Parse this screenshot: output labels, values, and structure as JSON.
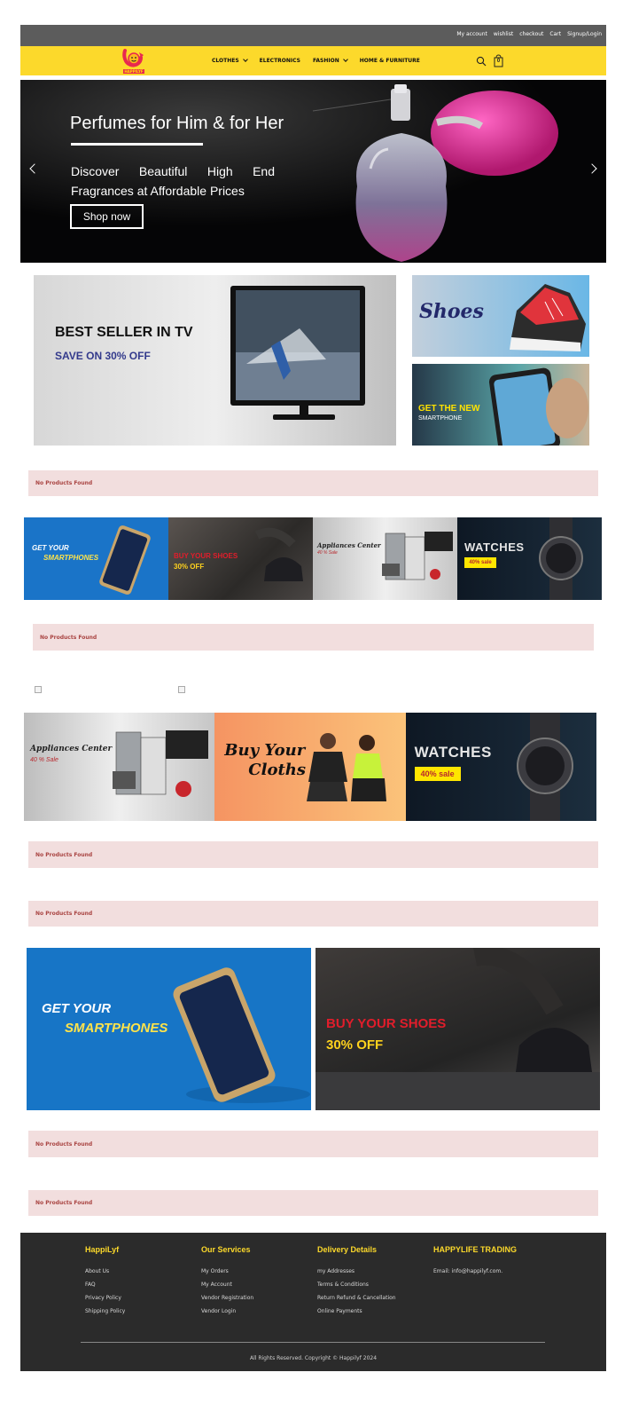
{
  "topbar": {
    "links": [
      "My account",
      "wishlist",
      "checkout",
      "Cart",
      "Signup/Login"
    ]
  },
  "brand": {
    "logo_text": "HAPPILYF",
    "colors": {
      "yellow": "#fcd92b",
      "dark": "#2b2b2b",
      "grey": "#5c5c5c"
    }
  },
  "nav": {
    "items": [
      {
        "label": "CLOTHES",
        "dropdown": true
      },
      {
        "label": "ELECTRONICS",
        "dropdown": false
      },
      {
        "label": "FASHION",
        "dropdown": true
      },
      {
        "label": "HOME & FURNITURE",
        "dropdown": false
      }
    ],
    "search_icon": "search-icon",
    "cart_count": "0"
  },
  "hero": {
    "title": "Perfumes for Him & for Her",
    "subtitle": "Discover Beautiful High End Fragrances at Affordable Prices",
    "button": "Shop now"
  },
  "promo": {
    "tv": {
      "headline": "BEST SELLER IN TV",
      "sub": "SAVE ON 30% OFF"
    },
    "shoes": {
      "label": "Shoes"
    },
    "phone": {
      "line1": "GET THE NEW",
      "line2": "SMARTPHONE"
    }
  },
  "empty_message": "No Products Found",
  "strip4": {
    "smart1": "GET YOUR",
    "smart2": "SMARTPHONES",
    "shoe1": "BUY YOUR SHOES",
    "shoe2": "30% OFF",
    "appl1": "Appliances Center",
    "appl2": "40 % Sale",
    "watch1": "WATCHES",
    "watch2": "40% sale"
  },
  "strip3": {
    "appl1": "Appliances Center",
    "appl2": "40 % Sale",
    "cloth1": "Buy Your",
    "cloth2": "Cloths",
    "watch1": "WATCHES",
    "watch2": "40% sale"
  },
  "big": {
    "smart1": "GET YOUR",
    "smart2": "SMARTPHONES",
    "shoe1": "BUY YOUR SHOES",
    "shoe2": "30% OFF"
  },
  "footer": {
    "col1": {
      "title": "HappiLyf",
      "links": [
        "About Us",
        "FAQ",
        "Privacy Policy",
        "Shipping Policy"
      ]
    },
    "col2": {
      "title": "Our Services",
      "links": [
        "My Orders",
        "My Account",
        "Vendor Registration",
        "Vendor Login"
      ]
    },
    "col3": {
      "title": "Delivery Details",
      "links": [
        "my Addresses",
        "Terms & Conditions",
        "Return Refund & Cancellation",
        "Online Payments"
      ]
    },
    "col4": {
      "title": "HAPPYLIFE TRADING",
      "links": [
        "Email: info@happilyf.com."
      ]
    },
    "copyright": "All Rights Reserved. Copyright © Happilyf 2024"
  }
}
